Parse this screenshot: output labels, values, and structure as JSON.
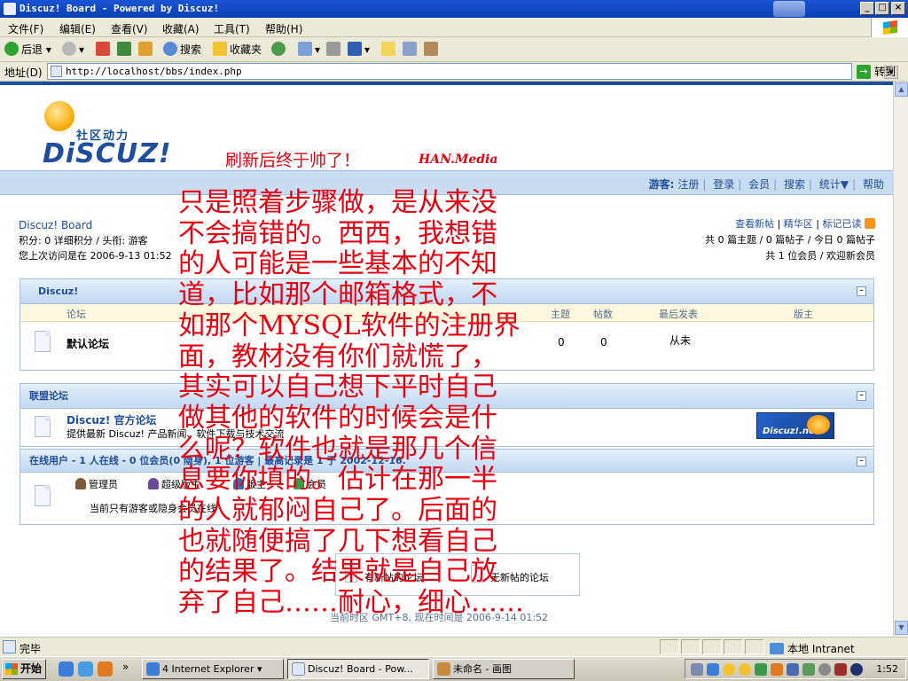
{
  "window": {
    "title": "Discuz! Board - Powered by Discuz!",
    "buttons": [
      "_",
      "□",
      "×"
    ]
  },
  "menu": [
    "文件(F)",
    "编辑(E)",
    "查看(V)",
    "收藏(A)",
    "工具(T)",
    "帮助(H)"
  ],
  "toolbar": {
    "back": "后退",
    "search": "搜索",
    "favorites": "收藏夹"
  },
  "address": {
    "label": "地址(D)",
    "url": "http://localhost/bbs/index.php",
    "go": "转到"
  },
  "page": {
    "logo_tagline": "社区动力",
    "logo_brand": "DiSCUZ!",
    "slogan": "刷新后终于帅了！",
    "signature": "HAN.Media",
    "nav": {
      "label": "游客:",
      "links": [
        "注册",
        "登录",
        "会员",
        "搜索",
        "统计▼",
        "帮助"
      ]
    },
    "board": {
      "name": "Discuz! Board",
      "points": "积分: 0 详细积分 / 头衔: 游客",
      "last_visit": "您上次访问是在 2006-9-13 01:52"
    },
    "stats": {
      "links": [
        "查看新帖",
        "精华区",
        "标记已读"
      ],
      "line2": "共 0 篇主题 / 0 篇帖子 / 今日 0 篇帖子",
      "line3": "共 1 位会员 / 欢迎新会员"
    },
    "category": {
      "title": "Discuz!",
      "columns": [
        "论坛",
        "主题",
        "帖数",
        "最后发表",
        "版主"
      ],
      "forum": {
        "name": "默认论坛",
        "topics": "0",
        "posts": "0",
        "last": "从未"
      }
    },
    "links_panel": {
      "title": "联盟论坛",
      "name": "Discuz! 官方论坛",
      "desc": "提供最新 Discuz! 产品新闻、软件下载与技术交流",
      "banner": "Discuz!.net"
    },
    "online": {
      "title": "在线用户 - 1 人在线 - 0 位会员(0 隐身), 1 位游客 | 最高记录是 1 于 2002-12-16.",
      "roles": [
        "管理员",
        "超级版主",
        "版主",
        "会员"
      ],
      "note": "当前只有游客或隐身会员在线"
    },
    "footer": {
      "new_posts": "有新帖的论坛",
      "no_new_posts": "无新帖的论坛",
      "timezone": "当前时区 GMT+8, 现在时间是 2006-9-14 01:52"
    },
    "overlay": [
      "只是照着步骤做，是从来没",
      "不会搞错的。西西，我想错",
      "的人可能是一些基本的不知",
      "道，比如那个邮箱格式，不",
      "如那个MYSQL软件的注册界",
      "面，教材没有你们就慌了，",
      "其实可以自己想下平时自己",
      "做其他的软件的时候会是什",
      "么呢？软件也就是那几个信",
      "息要你填的。估计在那一半",
      "的人就郁闷自己了。后面的",
      "也就随便搞了几下想看自己",
      "的结果了。结果就是自己放",
      "弃了自己……耐心，细心……"
    ]
  },
  "status": {
    "text": "完毕",
    "zone": "本地 Intranet"
  },
  "taskbar": {
    "start": "开始",
    "tasks": [
      "4 Internet Explorer",
      "Discuz! Board - Pow...",
      "未命名 - 画图"
    ],
    "clock": "1:52"
  }
}
